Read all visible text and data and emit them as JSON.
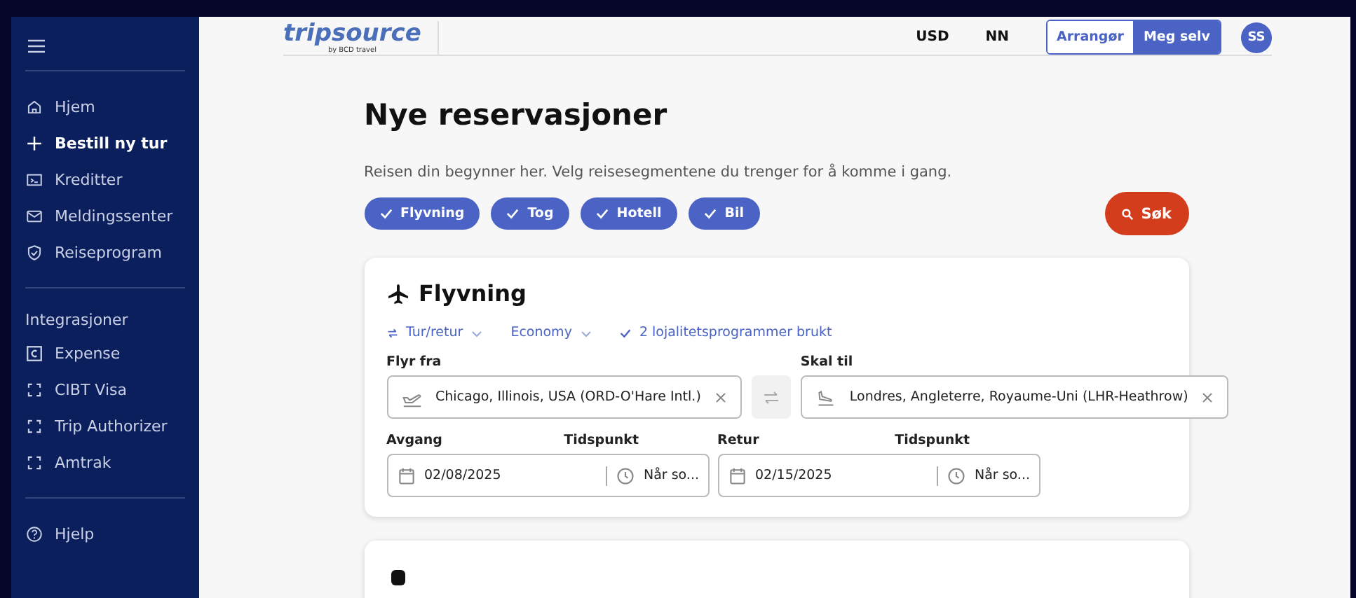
{
  "sidebar": {
    "items": [
      {
        "label": "Hjem",
        "selected": false
      },
      {
        "label": "Bestill ny tur",
        "selected": true
      },
      {
        "label": "Kreditter",
        "selected": false
      },
      {
        "label": "Meldingssenter",
        "selected": false
      },
      {
        "label": "Reiseprogram",
        "selected": false
      }
    ],
    "integrations_heading": "Integrasjoner",
    "integrations": [
      {
        "label": "Expense"
      },
      {
        "label": "CIBT Visa"
      },
      {
        "label": "Trip Authorizer"
      },
      {
        "label": "Amtrak"
      }
    ],
    "help": {
      "label": "Hjelp"
    }
  },
  "header": {
    "logo": "tripsource",
    "logo_sub": "by BCD travel",
    "currency": "USD",
    "language": "NN",
    "toggle": [
      {
        "label": "Arrangør",
        "selected": false
      },
      {
        "label": "Meg selv",
        "selected": true
      }
    ],
    "avatar": "SS"
  },
  "page": {
    "title": "Nye reservasjoner",
    "subtitle": "Reisen din begynner her. Velg reisesegmentene du trenger for å komme i gang.",
    "segments": [
      {
        "label": "Flyvning",
        "checked": true
      },
      {
        "label": "Tog",
        "checked": true
      },
      {
        "label": "Hotell",
        "checked": true
      },
      {
        "label": "Bil",
        "checked": true
      }
    ],
    "search_button": "Søk"
  },
  "flight": {
    "title": "Flyvning",
    "trip_type": "Tur/retur",
    "cabin": "Economy",
    "loyalty": "2 lojalitetsprogrammer brukt",
    "from_label": "Flyr fra",
    "from_value": "Chicago, Illinois, USA (ORD-O'Hare Intl.)",
    "to_label": "Skal til",
    "to_value": "Londres, Angleterre, Royaume-Uni (LHR-Heathrow)",
    "departure": {
      "label": "Avgang",
      "time_label": "Tidspunkt",
      "date": "02/08/2025",
      "time": "Når so..."
    },
    "return": {
      "label": "Retur",
      "time_label": "Tidspunkt",
      "date": "02/15/2025",
      "time": "Når so..."
    }
  }
}
